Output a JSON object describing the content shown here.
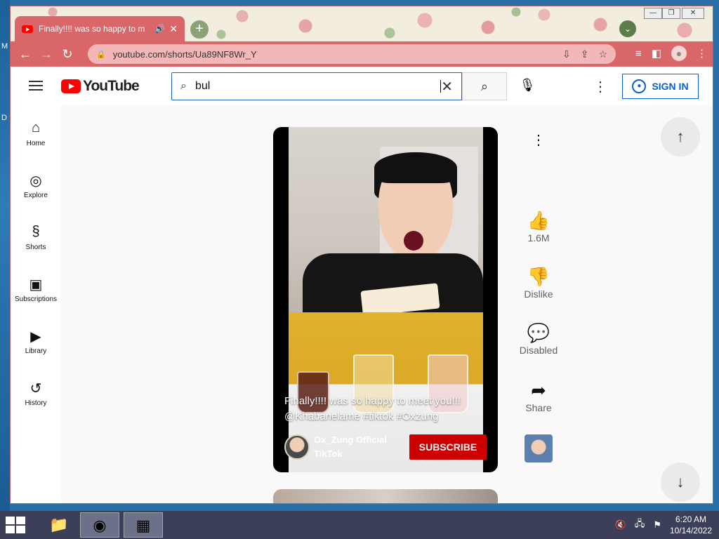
{
  "desktop": {
    "labels": [
      "M",
      "D"
    ]
  },
  "browser": {
    "tab_title": "Finally!!!! was so happy to m",
    "tab_close": "✕",
    "new_tab": "+",
    "url": "youtube.com/shorts/Ua89NF8Wr_Y",
    "window_controls": [
      "—",
      "❐",
      "✕"
    ]
  },
  "youtube": {
    "logo_text": "YouTube",
    "search": {
      "value": "bul"
    },
    "sign_in_label": "SIGN IN",
    "sidebar": [
      {
        "label": "Home",
        "icon": "home-icon",
        "glyph": "⌂"
      },
      {
        "label": "Explore",
        "icon": "compass-icon",
        "glyph": "◎"
      },
      {
        "label": "Shorts",
        "icon": "shorts-icon",
        "glyph": "§"
      },
      {
        "label": "Subscriptions",
        "icon": "subscriptions-icon",
        "glyph": "▣"
      },
      {
        "label": "Library",
        "icon": "library-icon",
        "glyph": "▶"
      },
      {
        "label": "History",
        "icon": "history-icon",
        "glyph": "↺"
      }
    ],
    "short": {
      "title": "Finally!!!! was so happy to meet you!!! @Khabanelame #tiktok #Oxzung",
      "channel": "Ox_Zung Official TikTok",
      "subscribe_label": "SUBSCRIBE"
    },
    "actions": {
      "likes": "1.6M",
      "dislike": "Dislike",
      "comments": "Disabled",
      "share": "Share"
    }
  },
  "taskbar": {
    "time": "6:20 AM",
    "date": "10/14/2022"
  },
  "colors": {
    "tab_bar": "#d9676a",
    "subscribe": "#cc0000",
    "sign_in": "#065fd4",
    "taskbar": "#3b3f57"
  }
}
